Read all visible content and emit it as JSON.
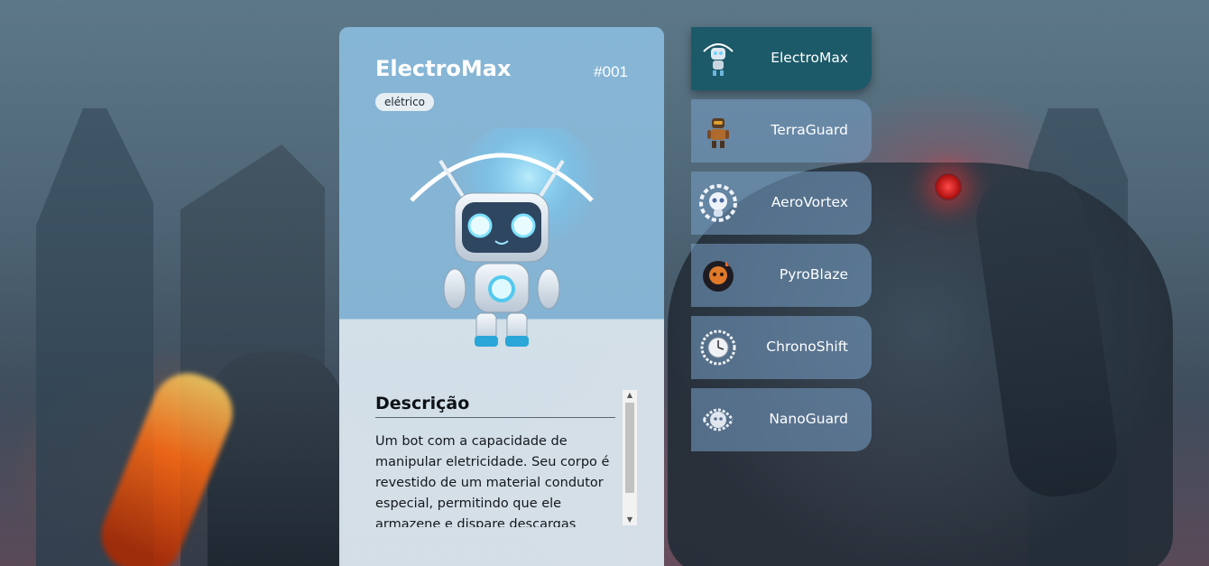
{
  "card": {
    "name": "ElectroMax",
    "number": "#001",
    "type": "elétrico",
    "description_title": "Descrição",
    "description": "Um bot com a capacidade de manipular eletricidade. Seu corpo é revestido de um material condutor especial, permitindo que ele armazene e dispare descargas"
  },
  "robot_list": [
    {
      "name": "ElectroMax",
      "icon": "robot-electromax-icon",
      "active": true
    },
    {
      "name": "TerraGuard",
      "icon": "robot-terraguard-icon",
      "active": false
    },
    {
      "name": "AeroVortex",
      "icon": "robot-aerovortex-icon",
      "active": false
    },
    {
      "name": "PyroBlaze",
      "icon": "robot-pyroblaze-icon",
      "active": false
    },
    {
      "name": "ChronoShift",
      "icon": "robot-chronoshift-icon",
      "active": false
    },
    {
      "name": "NanoGuard",
      "icon": "robot-nanoguard-icon",
      "active": false
    }
  ],
  "colors": {
    "active_item": "#1c5a6a",
    "card_top": "#8abbdc",
    "card_bottom": "#deeaf2"
  }
}
